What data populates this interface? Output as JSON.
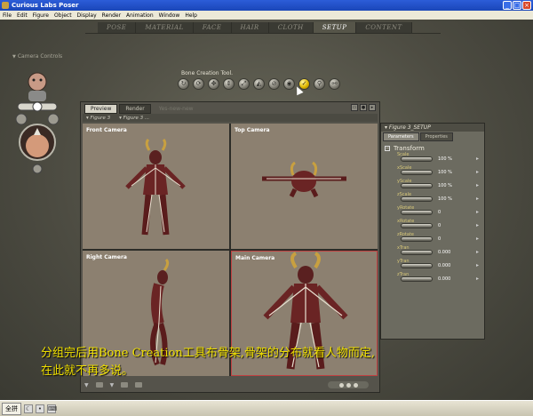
{
  "window": {
    "title": "Curious Labs Poser"
  },
  "menu": [
    "File",
    "Edit",
    "Figure",
    "Object",
    "Display",
    "Render",
    "Animation",
    "Window",
    "Help"
  ],
  "room_tabs": [
    {
      "label": "POSE",
      "active": false
    },
    {
      "label": "MATERIAL",
      "active": false
    },
    {
      "label": "FACE",
      "active": false
    },
    {
      "label": "HAIR",
      "active": false
    },
    {
      "label": "CLOTH",
      "active": false
    },
    {
      "label": "SETUP",
      "active": true
    },
    {
      "label": "CONTENT",
      "active": false
    }
  ],
  "camera_controls": {
    "label": "Camera Controls"
  },
  "tool_bar": {
    "title": "Bone Creation Tool."
  },
  "document": {
    "tabs": [
      "Preview",
      "Render",
      "Yes-new-new"
    ],
    "selectors": [
      "Figure 3",
      "Figure 3 ..."
    ],
    "viewports": [
      {
        "label": "Front Camera"
      },
      {
        "label": "Top Camera"
      },
      {
        "label": "Right Camera"
      },
      {
        "label": "Main Camera"
      }
    ]
  },
  "params_panel": {
    "title": "Figure 3_SETUP",
    "tabs": [
      "Parameters",
      "Properties"
    ],
    "group": "Transform",
    "rows": [
      {
        "name": "Scale",
        "value": "100 %"
      },
      {
        "name": "xScale",
        "value": "100 %"
      },
      {
        "name": "yScale",
        "value": "100 %"
      },
      {
        "name": "zScale",
        "value": "100 %"
      },
      {
        "name": "yRotate",
        "value": "0"
      },
      {
        "name": "xRotate",
        "value": "0"
      },
      {
        "name": "zRotate",
        "value": "0"
      },
      {
        "name": "xTran",
        "value": "0.000"
      },
      {
        "name": "yTran",
        "value": "0.000"
      },
      {
        "name": "zTran",
        "value": "0.000"
      }
    ]
  },
  "subtitle": {
    "line1": "分组完后用Bone Creation工具布骨架,骨架的分布就看人物而定,",
    "line2": "在此就不再多说。"
  },
  "taskbar": {
    "ime": "全拼"
  },
  "colors": {
    "accent": "#f0e000",
    "selected_tool": "#e0b800",
    "main_camera_border": "#c04040"
  }
}
